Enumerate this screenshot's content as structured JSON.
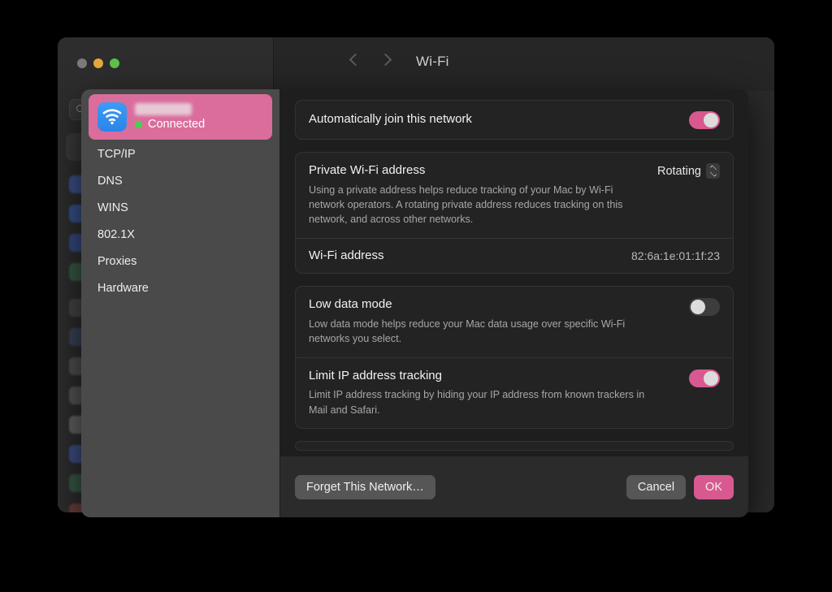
{
  "window": {
    "title": "Wi-Fi",
    "traffic_lights": [
      "close",
      "minimize",
      "maximize"
    ],
    "nav_back_icon": "chevron-left-icon",
    "nav_forward_icon": "chevron-right-icon",
    "search_placeholder": ""
  },
  "sheet": {
    "network": {
      "icon": "wifi-icon",
      "ssid": "",
      "ssid_redacted": true,
      "status": "Connected",
      "status_color": "#46d24a",
      "row_color": "#da6d9c"
    },
    "sidebar_items": [
      {
        "label": "TCP/IP"
      },
      {
        "label": "DNS"
      },
      {
        "label": "WINS"
      },
      {
        "label": "802.1X"
      },
      {
        "label": "Proxies"
      },
      {
        "label": "Hardware"
      }
    ],
    "groups": [
      {
        "rows": [
          {
            "title": "Automatically join this network",
            "desc": "",
            "control": "toggle",
            "toggle_on": true
          }
        ]
      },
      {
        "rows": [
          {
            "title": "Private Wi-Fi address",
            "desc": "Using a private address helps reduce tracking of your Mac by Wi-Fi network operators. A rotating private address reduces tracking on this network, and across other networks.",
            "control": "popup",
            "value": "Rotating"
          },
          {
            "title": "Wi-Fi address",
            "desc": "",
            "control": "text",
            "value": "82:6a:1e:01:1f:23"
          }
        ]
      },
      {
        "rows": [
          {
            "title": "Low data mode",
            "desc": "Low data mode helps reduce your Mac data usage over specific Wi-Fi networks you select.",
            "control": "toggle",
            "toggle_on": false
          },
          {
            "title": "Limit IP address tracking",
            "desc": "Limit IP address tracking by hiding your IP address from known trackers in Mail and Safari.",
            "control": "toggle",
            "toggle_on": true
          }
        ]
      }
    ],
    "footer": {
      "forget_label": "Forget This Network…",
      "cancel_label": "Cancel",
      "ok_label": "OK"
    }
  },
  "colors": {
    "accent": "#d8598f",
    "network_row": "#da6d9c",
    "status_green": "#46d24a",
    "sidebar": "#4a4a4a",
    "content_bg": "#1e1e1e"
  }
}
